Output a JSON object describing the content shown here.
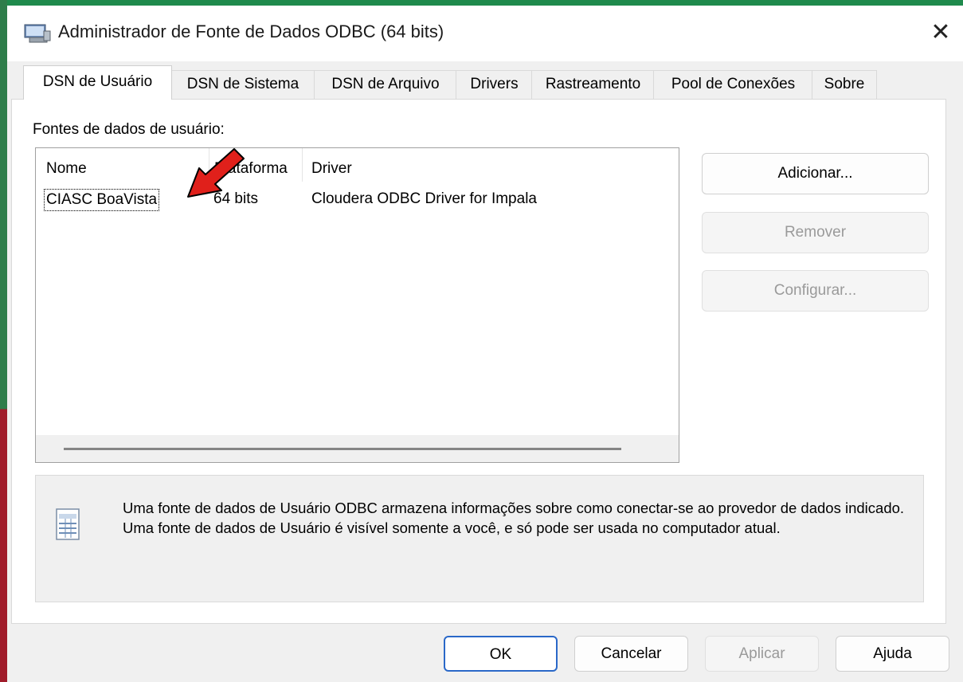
{
  "window": {
    "title": "Administrador de Fonte de Dados ODBC (64 bits)",
    "close_glyph": "✕",
    "app_icon": "odbc-admin-icon"
  },
  "tabs": [
    {
      "label": "DSN de Usuário",
      "active": true
    },
    {
      "label": "DSN de Sistema",
      "active": false
    },
    {
      "label": "DSN de Arquivo",
      "active": false
    },
    {
      "label": "Drivers",
      "active": false
    },
    {
      "label": "Rastreamento",
      "active": false
    },
    {
      "label": "Pool de Conexões",
      "active": false
    },
    {
      "label": "Sobre",
      "active": false
    }
  ],
  "user_dsn": {
    "group_label": "Fontes de dados de usuário:",
    "columns": [
      "Nome",
      "Plataforma",
      "Driver"
    ],
    "rows": [
      {
        "name": "CIASC BoaVista",
        "platform": "64 bits",
        "driver": "Cloudera ODBC Driver for Impala"
      }
    ],
    "buttons": {
      "add": {
        "label": "Adicionar...",
        "enabled": true
      },
      "remove": {
        "label": "Remover",
        "enabled": false
      },
      "configure": {
        "label": "Configurar...",
        "enabled": false
      }
    },
    "info_text": "Uma fonte de dados de Usuário ODBC armazena informações sobre como conectar-se ao provedor de dados indicado. Uma fonte de dados de Usuário é visível somente a você, e só pode ser usada no computador atual."
  },
  "dialog_buttons": {
    "ok": {
      "label": "OK",
      "enabled": true
    },
    "cancel": {
      "label": "Cancelar",
      "enabled": true
    },
    "apply": {
      "label": "Aplicar",
      "enabled": false
    },
    "help": {
      "label": "Ajuda",
      "enabled": true
    }
  },
  "colors": {
    "annotation_arrow": "#e0201b",
    "default_button_border": "#2a68c8"
  }
}
